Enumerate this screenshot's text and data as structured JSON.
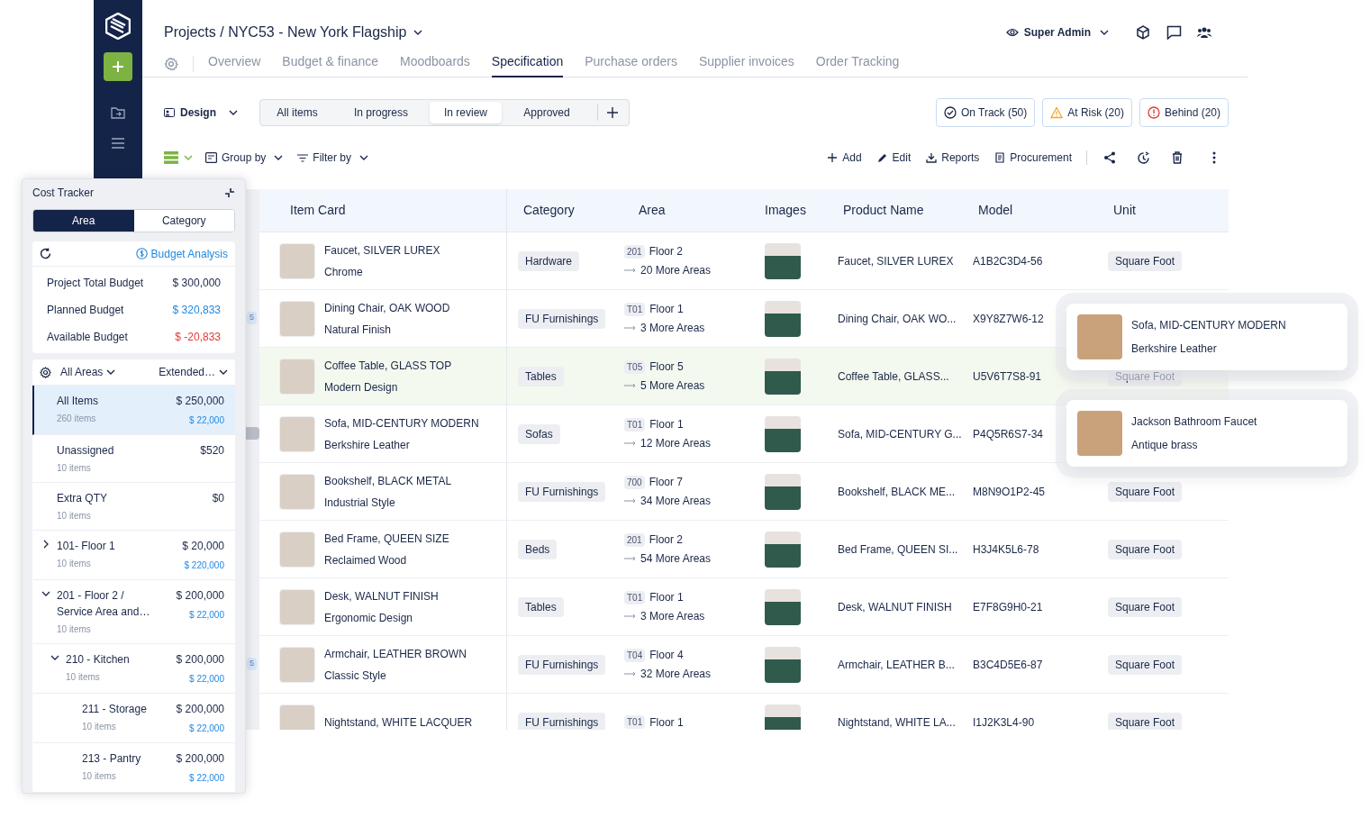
{
  "header": {
    "title": "Projects / NYC53 - New York Flagship",
    "user": "Super Admin"
  },
  "nav_tabs": [
    {
      "label": "Overview",
      "selected": false
    },
    {
      "label": "Budget & finance",
      "selected": false
    },
    {
      "label": "Moodboards",
      "selected": false
    },
    {
      "label": "Specification",
      "selected": true
    },
    {
      "label": "Purchase orders",
      "selected": false
    },
    {
      "label": "Supplier invoices",
      "selected": false
    },
    {
      "label": "Order Tracking",
      "selected": false
    }
  ],
  "view": {
    "label": "Design"
  },
  "status_filters": [
    {
      "label": "All items",
      "selected": false
    },
    {
      "label": "In progress",
      "selected": false
    },
    {
      "label": "In review",
      "selected": true
    },
    {
      "label": "Approved",
      "selected": false
    }
  ],
  "status_badges": [
    {
      "kind": "on_track",
      "label": "On Track (50)"
    },
    {
      "kind": "at_risk",
      "label": "At Risk (20)"
    },
    {
      "kind": "behind",
      "label": "Behind (20)"
    }
  ],
  "toolbar": {
    "group_by": "Group by",
    "filter_by": "Filter by",
    "actions": [
      {
        "kind": "add",
        "label": "Add"
      },
      {
        "kind": "edit",
        "label": "Edit"
      },
      {
        "kind": "reports",
        "label": "Reports"
      },
      {
        "kind": "procurement",
        "label": "Procurement"
      }
    ]
  },
  "table": {
    "columns": [
      "Item Card",
      "Category",
      "Area",
      "Images",
      "Product Name",
      "Model",
      "Unit"
    ],
    "rows": [
      {
        "item_name": "Faucet, SILVER LUREX",
        "item_variant": "Chrome",
        "category": "Hardware",
        "area_code": "201",
        "area_name": "Floor 2",
        "more_areas": "20 More Areas",
        "product_name": "Faucet, SILVER LUREX",
        "model": "A1B2C3D4-56",
        "unit": "Square Foot",
        "selected": false
      },
      {
        "item_name": "Dining Chair, OAK WOOD",
        "item_variant": "Natural Finish",
        "category": "FU Furnishings",
        "area_code": "T01",
        "area_name": "Floor 1",
        "more_areas": "3 More Areas",
        "product_name": "Dining Chair, OAK WO...",
        "model": "X9Y8Z7W6-12",
        "selected": false
      },
      {
        "item_name": "Coffee Table, GLASS TOP",
        "item_variant": "Modern Design",
        "category": "Tables",
        "area_code": "T05",
        "area_name": "Floor 5",
        "more_areas": "5 More Areas",
        "product_name": "Coffee Table, GLASS...",
        "model": "U5V6T7S8-91",
        "unit": "Square Foot",
        "selected": true
      },
      {
        "item_name": "Sofa, MID-CENTURY MODERN",
        "item_variant": "Berkshire Leather",
        "category": "Sofas",
        "area_code": "T01",
        "area_name": "Floor 1",
        "more_areas": "12 More Areas",
        "product_name": "Sofa, MID-CENTURY G...",
        "model": "P4Q5R6S7-34",
        "selected": false
      },
      {
        "item_name": "Bookshelf, BLACK METAL",
        "item_variant": "Industrial Style",
        "category": "FU Furnishings",
        "area_code": "700",
        "area_name": "Floor 7",
        "more_areas": "34 More Areas",
        "product_name": "Bookshelf, BLACK ME...",
        "model": "M8N9O1P2-45",
        "unit": "Square Foot",
        "selected": false
      },
      {
        "item_name": "Bed Frame, QUEEN SIZE",
        "item_variant": "Reclaimed Wood",
        "category": "Beds",
        "area_code": "201",
        "area_name": "Floor 2",
        "more_areas": "54 More Areas",
        "product_name": "Bed Frame, QUEEN SI...",
        "model": "H3J4K5L6-78",
        "unit": "Square Foot",
        "selected": false
      },
      {
        "item_name": "Desk, WALNUT FINISH",
        "item_variant": "Ergonomic Design",
        "category": "Tables",
        "area_code": "T01",
        "area_name": "Floor 1",
        "more_areas": "3 More Areas",
        "product_name": "Desk, WALNUT FINISH",
        "model": "E7F8G9H0-21",
        "unit": "Square Foot",
        "selected": false
      },
      {
        "item_name": "Armchair, LEATHER BROWN",
        "item_variant": "Classic Style",
        "category": "FU Furnishings",
        "area_code": "T04",
        "area_name": "Floor 4",
        "more_areas": "32 More Areas",
        "product_name": "Armchair, LEATHER B...",
        "model": "B3C4D5E6-87",
        "unit": "Square Foot",
        "selected": false
      },
      {
        "item_name": "Nightstand, WHITE LACQUER",
        "category": "FU Furnishings",
        "area_code": "T01",
        "area_name": "Floor 1",
        "product_name": "Nightstand, WHITE LA...",
        "model": "I1J2K3L4-90",
        "unit": "Square Foot",
        "selected": false
      }
    ]
  },
  "side_badges": [
    "5",
    "5"
  ],
  "cost_tracker": {
    "title": "Cost Tracker",
    "modes": [
      {
        "label": "Area",
        "selected": true
      },
      {
        "label": "Category",
        "selected": false
      }
    ],
    "analysis_link": "Budget Analysis",
    "budget": [
      {
        "kind": "total",
        "label": "Project Total Budget",
        "value": "$ 300,000"
      },
      {
        "kind": "planned",
        "label": "Planned Budget",
        "value": "$ 320,833"
      },
      {
        "kind": "available",
        "label": "Available Budget",
        "value": "$ -20,833"
      }
    ],
    "area_filter": "All Areas",
    "view_filter": "Extended…",
    "areas": [
      {
        "kind": "leaf",
        "name": "All Items",
        "count": "260 items",
        "amount": "$ 250,000",
        "sub_amount": "$ 22,000",
        "selected": true
      },
      {
        "kind": "leaf",
        "name": "Unassigned",
        "count": "10 items",
        "amount": "$520",
        "selected": false
      },
      {
        "kind": "leaf",
        "name": "Extra QTY",
        "count": "10 items",
        "amount": "$0",
        "selected": false
      },
      {
        "kind": "group",
        "name": "101- Floor 1",
        "count": "10 items",
        "amount": "$ 20,000",
        "sub_amount": "$ 220,000",
        "selected": false,
        "expanded": false
      },
      {
        "kind": "group",
        "name": "201 - Floor 2 / Service Area and…",
        "count": "10 items",
        "amount": "$ 200,000",
        "sub_amount": "$ 22,000",
        "selected": false,
        "expanded": true,
        "children": [
          {
            "kind": "group",
            "name": "210 - Kitchen",
            "count": "10 items",
            "amount": "$ 200,000",
            "sub_amount": "$ 22,000",
            "selected": false,
            "expanded": true,
            "children": [
              {
                "kind": "leaf",
                "name": "211 - Storage",
                "count": "10 items",
                "amount": "$ 200,000",
                "sub_amount": "$ 22,000",
                "selected": false
              },
              {
                "kind": "leaf",
                "name": "213 - Pantry",
                "count": "10 items",
                "amount": "$ 200,000",
                "sub_amount": "$ 22,000",
                "selected": false
              }
            ]
          }
        ]
      }
    ]
  },
  "hover_cards": [
    {
      "title": "Sofa, MID-CENTURY MODERN",
      "subtitle": "Berkshire Leather"
    },
    {
      "title": "Jackson Bathroom Faucet",
      "subtitle": "Antique brass"
    }
  ]
}
